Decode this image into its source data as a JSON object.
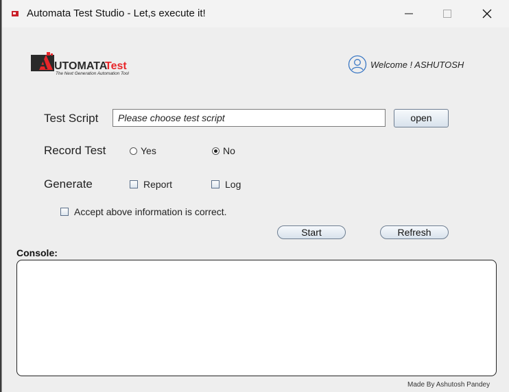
{
  "window": {
    "title": "Automata Test Studio - Let,s execute it!"
  },
  "header": {
    "logo_text_main": "UTOMATA",
    "logo_text_accent": "Test",
    "logo_letter": "A",
    "logo_tagline": "The Next Generation Automation Tool",
    "welcome_text": "Welcome ! ASHUTOSH"
  },
  "form": {
    "test_script_label": "Test Script",
    "test_script_value": "",
    "test_script_placeholder": "Please choose test script",
    "open_button": "open",
    "record_label": "Record Test",
    "record_options": [
      {
        "label": "Yes",
        "selected": false
      },
      {
        "label": "No",
        "selected": true
      }
    ],
    "generate_label": "Generate",
    "generate_options": [
      {
        "label": "Report",
        "checked": false
      },
      {
        "label": "Log",
        "checked": false
      }
    ],
    "accept_label": "Accept above information is correct.",
    "accept_checked": false,
    "start_button": "Start",
    "refresh_button": "Refresh"
  },
  "console": {
    "label": "Console:",
    "content": ""
  },
  "footer": {
    "credit": "Made By Ashutosh Pandey"
  },
  "colors": {
    "logo_red": "#e8262a",
    "logo_dark": "#2a2a2a",
    "accent_blue": "#3b78c4"
  }
}
